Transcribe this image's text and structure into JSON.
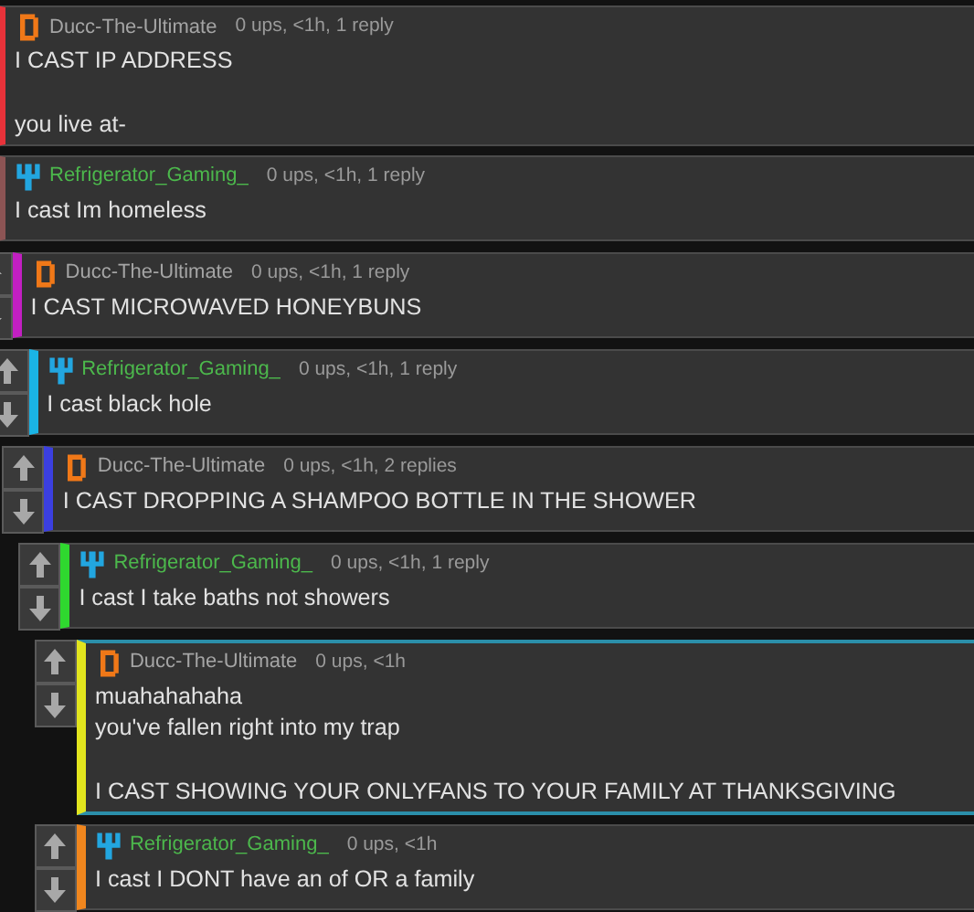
{
  "comments": [
    {
      "user": "Ducc-The-Ultimate",
      "kind": "block",
      "meta": "0 ups, <1h, 1 reply",
      "color": "#e8323a",
      "highlighted": false,
      "paragraphs": [
        [
          "I CAST IP ADDRESS"
        ],
        [
          "you live at-"
        ]
      ],
      "children": [
        {
          "user": "Refrigerator_Gaming_",
          "kind": "pixel",
          "meta": "0 ups, <1h, 1 reply",
          "color": "#8c5454",
          "highlighted": false,
          "paragraphs": [
            [
              "I cast Im homeless"
            ]
          ],
          "children": [
            {
              "user": "Ducc-The-Ultimate",
              "kind": "block",
              "meta": "0 ups, <1h, 1 reply",
              "color": "#c21fc2",
              "highlighted": false,
              "paragraphs": [
                [
                  "I CAST MICROWAVED HONEYBUNS"
                ]
              ],
              "children": [
                {
                  "user": "Refrigerator_Gaming_",
                  "kind": "pixel",
                  "meta": "0 ups, <1h, 1 reply",
                  "color": "#1ab4e6",
                  "highlighted": false,
                  "paragraphs": [
                    [
                      "I cast black hole"
                    ]
                  ],
                  "children": [
                    {
                      "user": "Ducc-The-Ultimate",
                      "kind": "block",
                      "meta": "0 ups, <1h, 2 replies",
                      "color": "#3b3fe0",
                      "highlighted": false,
                      "paragraphs": [
                        [
                          "I CAST DROPPING A SHAMPOO BOTTLE IN THE SHOWER"
                        ]
                      ],
                      "children": [
                        {
                          "user": "Refrigerator_Gaming_",
                          "kind": "pixel",
                          "meta": "0 ups, <1h, 1 reply",
                          "color": "#2fd82f",
                          "highlighted": false,
                          "paragraphs": [
                            [
                              "I cast I take baths not showers"
                            ]
                          ],
                          "children": [
                            {
                              "user": "Ducc-The-Ultimate",
                              "kind": "block",
                              "meta": "0 ups, <1h",
                              "color": "#e2e51e",
                              "highlighted": true,
                              "paragraphs": [
                                [
                                  "muahahahaha",
                                  "you've fallen right into my trap"
                                ],
                                [
                                  "I CAST SHOWING YOUR ONLYFANS TO YOUR FAMILY AT THANKSGIVING"
                                ]
                              ]
                            },
                            {
                              "user": "Refrigerator_Gaming_",
                              "kind": "pixel",
                              "meta": "0 ups, <1h",
                              "color": "#f0861e",
                              "highlighted": false,
                              "paragraphs": [
                                [
                                  "I cast I DONT have an of OR a family"
                                ]
                              ]
                            }
                          ]
                        }
                      ]
                    }
                  ]
                }
              ]
            }
          ]
        }
      ]
    }
  ]
}
